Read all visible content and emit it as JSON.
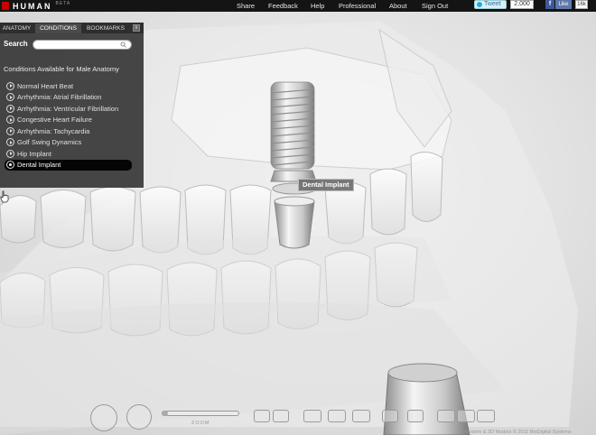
{
  "app": {
    "brand": "HUMAN",
    "beta": "BETA"
  },
  "topnav": {
    "share": "Share",
    "feedback": "Feedback",
    "help": "Help",
    "professional": "Professional",
    "about": "About",
    "signout": "Sign Out"
  },
  "social": {
    "tweet_label": "Tweet",
    "tweet_count": "2,000",
    "fb_icon": "f",
    "like_label": "Like",
    "like_count": "16k"
  },
  "panel": {
    "tabs": [
      "ANATOMY",
      "CONDITIONS",
      "BOOKMARKS"
    ],
    "active_tab": "CONDITIONS",
    "close_icon": "x",
    "search_label": "Search",
    "search_value": "",
    "conditions_header": "Conditions Available for Male Anatomy",
    "conditions": [
      "Normal Heart Beat",
      "Arrhythmia: Atrial Fibrillation",
      "Arrhythmia: Ventricular Fibrillation",
      "Congestive Heart Failure",
      "Arrhythmia: Tachycardia",
      "Golf Swing Dynamics",
      "Hip Implant",
      "Dental Implant"
    ],
    "selected_condition": "Dental Implant"
  },
  "viewport": {
    "tooltip": "Dental Implant"
  },
  "toolbar": {
    "zoom_label": "ZOOM",
    "icons": [
      "rotate-icon",
      "pan-icon",
      "slider-icon",
      "gender-icon",
      "pin-icon",
      "tag-icon",
      "camera-icon",
      "eraser-icon",
      "layers-icon",
      "grid-icon",
      "anatomy-view-icon",
      "skeleton-view-icon",
      "muscle-view-icon"
    ]
  },
  "footer": {
    "copyright": "System & 3D Models © 2011 BioDigital Systems"
  }
}
